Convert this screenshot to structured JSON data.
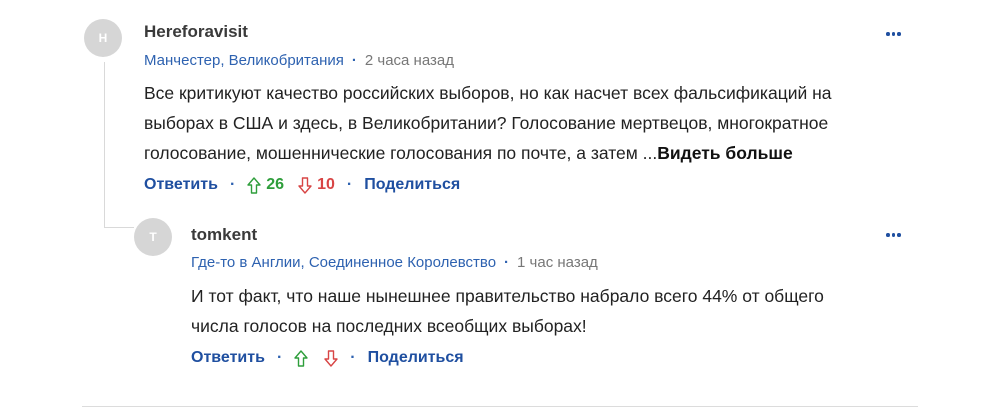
{
  "comments": [
    {
      "avatar_letter": "H",
      "author": "Hereforavisit",
      "location": "Манчестер, Великобритания",
      "separator": "·",
      "time": "2 часа назад",
      "text_lines": [
        "Все критикуют качество российских выборов, но как насчет всех фальсификаций на",
        "выборах в США и здесь, в Великобритании? Голосование мертвецов, многократное",
        "голосование, мошеннические голосования по почте, а затем ..."
      ],
      "see_more": "Видеть больше",
      "reply": "Ответить",
      "upvotes": "26",
      "downvotes": "10",
      "share": "Поделиться",
      "more_icon": "more-horizontal-icon"
    },
    {
      "avatar_letter": "T",
      "author": "tomkent",
      "location": "Где-то в Англии, Соединенное Королевство",
      "separator": "·",
      "time": "1 час назад",
      "text_lines": [
        "И тот факт, что наше нынешнее правительство набрало всего 44% от общего",
        "числа голосов на последних всеобщих выборах!"
      ],
      "reply": "Ответить",
      "share": "Поделиться",
      "more_icon": "more-horizontal-icon"
    }
  ],
  "colors": {
    "link_blue": "#1f4fa0",
    "upvote_green": "#2e9e3b",
    "downvote_red": "#d84545",
    "avatar_gray": "#d6d6d6"
  }
}
